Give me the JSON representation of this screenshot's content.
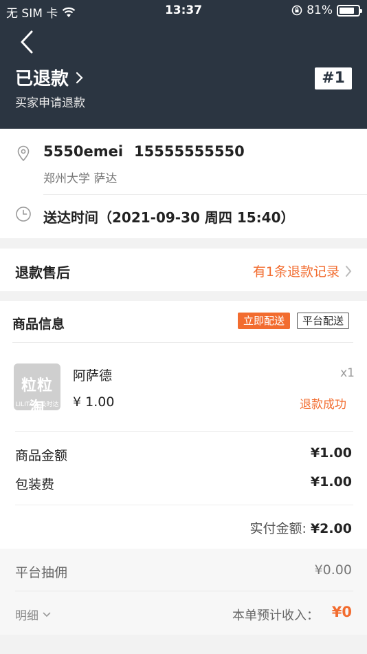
{
  "status_bar": {
    "carrier": "无 SIM 卡",
    "time": "13:37",
    "battery": "81%",
    "battery_level": 0.81
  },
  "header": {
    "title": "已退款",
    "subtitle": "买家申请退款",
    "order_no": "#1"
  },
  "address": {
    "name": "5550emei",
    "phone": "15555555550",
    "detail": "郑州大学 萨达",
    "delivery_time": "送达时间（2021-09-30 周四 15:40）"
  },
  "refund": {
    "title": "退款售后",
    "link": "有1条退款记录"
  },
  "goods": {
    "title": "商品信息",
    "tags": [
      "立即配送",
      "平台配送"
    ],
    "item": {
      "thumb_title": "粒粒淘",
      "thumb_sub": "LILITAO 及时达",
      "name": "阿萨德",
      "qty": "x1",
      "price": "¥ 1.00",
      "status": "退款成功"
    },
    "fees": [
      {
        "label": "商品金额",
        "value": "¥1.00"
      },
      {
        "label": "包装费",
        "value": "¥1.00"
      }
    ],
    "paid_label": "实付金额:",
    "paid_value": "¥2.00"
  },
  "summary": {
    "commission_label": "平台抽佣",
    "commission_value": "¥0.00",
    "detail": "明细",
    "income_label": "本单预计收入：",
    "income_value": "¥0"
  },
  "colors": {
    "header_bg": "#2b3541",
    "accent": "#f26c2f"
  }
}
